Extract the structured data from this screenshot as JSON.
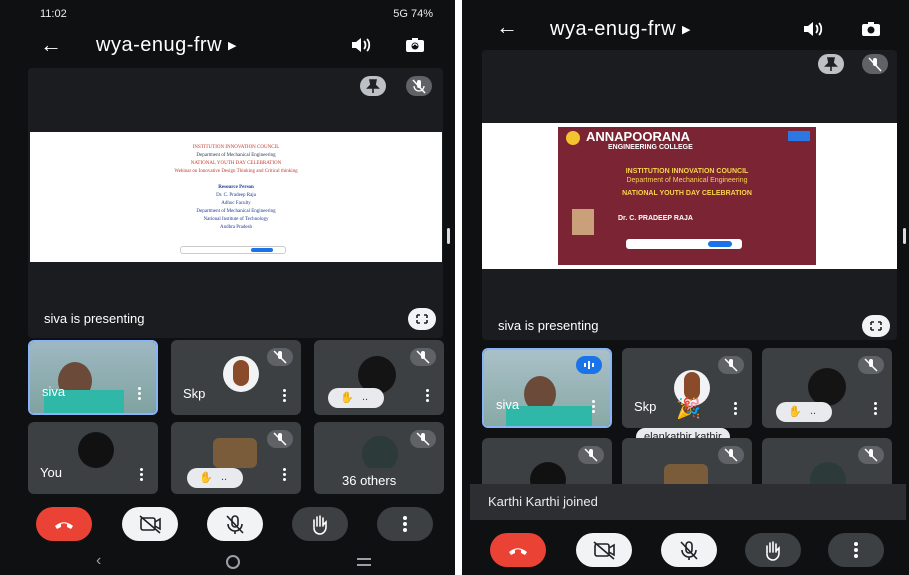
{
  "left": {
    "status": {
      "time": "11:02",
      "right": "5G 74%"
    },
    "meeting_code": "wya-enug-frw",
    "presenting_label": "siva is presenting",
    "slide": {
      "line1": "INSTITUTION INNOVATION COUNCIL",
      "line2": "Department of Mechanical Engineering",
      "line3": "NATIONAL YOUTH DAY CELEBRATION",
      "line4": "Webinar on Innovative Design Thinking and Critical thinking",
      "rp_title": "Resource Person",
      "rp_name": "Dr. C. Pradeep Raja",
      "rp_1": "Adhoc Faculty",
      "rp_2": "Department of Mechanical Engineering",
      "rp_3": "National Institute of Technology",
      "rp_4": "Andhra Pradesh"
    },
    "tiles": [
      {
        "name": "siva"
      },
      {
        "name": "Skp"
      },
      {
        "name": ""
      },
      {
        "name": "You"
      },
      {
        "name": ""
      },
      {
        "name": ""
      }
    ],
    "others_label": "36 others",
    "react_pill": ".."
  },
  "right": {
    "meeting_code": "wya-enug-frw",
    "presenting_label": "siva is presenting",
    "slide": {
      "college": "ANNAPOORANA",
      "college2": "ENGINEERING COLLEGE",
      "line1": "INSTITUTION INNOVATION COUNCIL",
      "line2": "Department of Mechanical Engineering",
      "line3": "NATIONAL YOUTH DAY CELEBRATION",
      "speaker": "Dr. C. PRADEEP RAJA"
    },
    "tiles": [
      {
        "name": "siva"
      },
      {
        "name": "Skp"
      },
      {
        "name": ""
      },
      {
        "name": ""
      },
      {
        "name": ""
      },
      {
        "name": ""
      }
    ],
    "tooltip": "elankathir kathir",
    "toast": "Karthi Karthi joined",
    "react_pill": ".."
  },
  "colors": {
    "end_call": "#ea4335",
    "tile": "#3c4043",
    "accent": "#8ab4f8"
  }
}
